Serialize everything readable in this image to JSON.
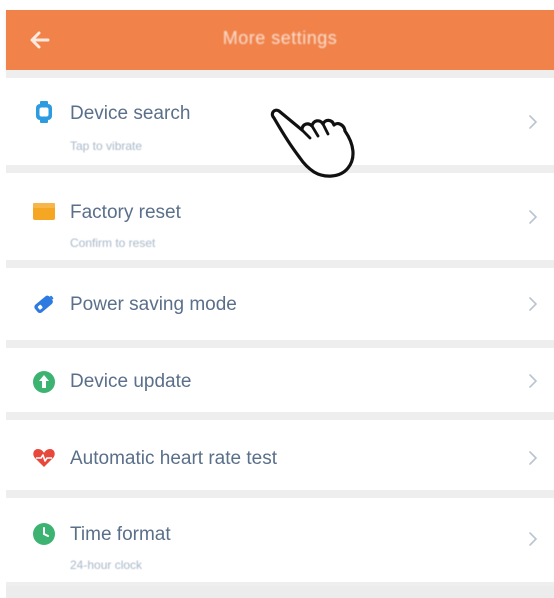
{
  "header": {
    "title": "More settings",
    "back_icon": "back-arrow-icon"
  },
  "colors": {
    "accent": "#f0824a",
    "title_text": "#5a6f8a",
    "subtitle_text": "#a8b8c8",
    "divider": "#eeeeee"
  },
  "settings": [
    {
      "title": "Device search",
      "subtitle": "Tap to vibrate",
      "icon": "watch-icon",
      "icon_color": "#2d9be0"
    },
    {
      "title": "Factory reset",
      "subtitle": "Confirm to reset",
      "icon": "reset-box-icon",
      "icon_color": "#f5a623"
    },
    {
      "title": "Power saving mode",
      "subtitle": "",
      "icon": "battery-icon",
      "icon_color": "#2d7be0"
    },
    {
      "title": "Device update",
      "subtitle": "",
      "icon": "update-icon",
      "icon_color": "#3cb371"
    },
    {
      "title": "Automatic heart rate test",
      "subtitle": "",
      "icon": "heart-icon",
      "icon_color": "#e8473b"
    },
    {
      "title": "Time format",
      "subtitle": "24-hour clock",
      "icon": "clock-icon",
      "icon_color": "#3cb371"
    }
  ],
  "overlay": {
    "icon": "pointing-hand-icon"
  }
}
